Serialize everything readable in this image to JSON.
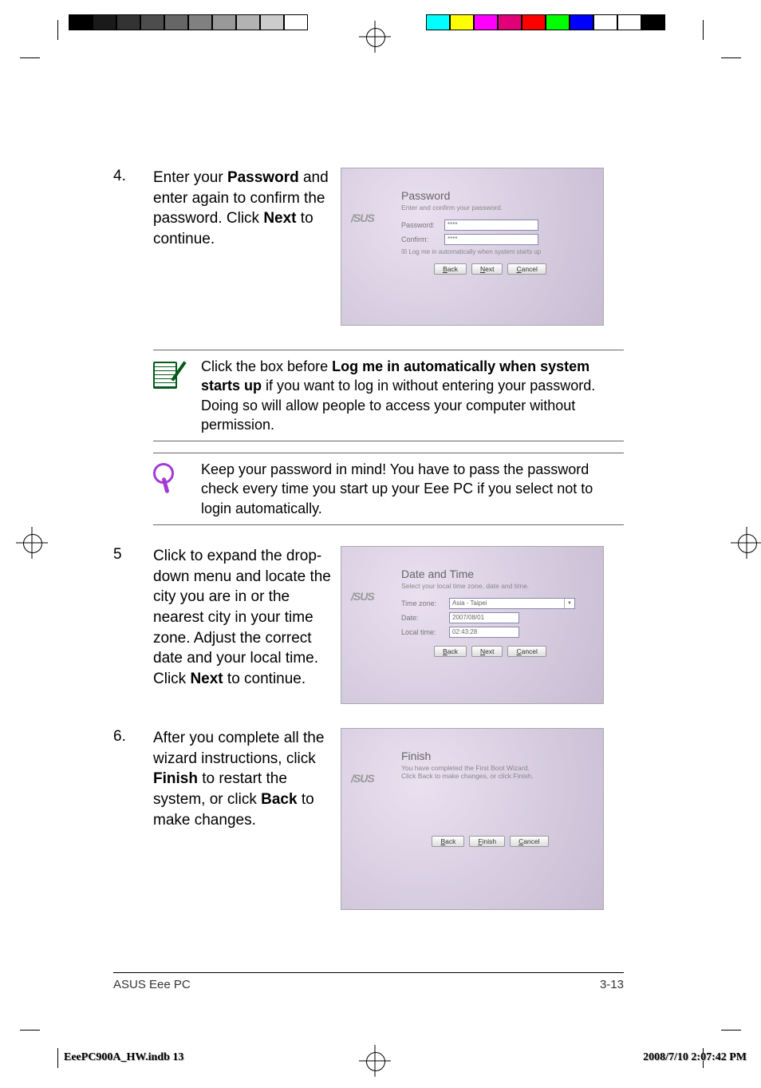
{
  "steps": {
    "s4": {
      "num": "4.",
      "text_pre": "Enter your ",
      "text_b1": "Password",
      "text_mid": " and enter again to confirm the password. Click ",
      "text_b2": "Next",
      "text_post": " to continue."
    },
    "s5": {
      "num": "5",
      "text_pre": "Click to expand the drop-down menu and locate the city you are in or the nearest city in your time zone. Adjust the correct date and your local time. Click ",
      "text_b1": "Next",
      "text_post": " to continue."
    },
    "s6": {
      "num": "6.",
      "text_pre": "After you complete all the wizard instructions, click ",
      "text_b1": "Finish",
      "text_mid": " to restart the system, or click ",
      "text_b2": "Back",
      "text_post": " to make changes."
    }
  },
  "dialogs": {
    "password": {
      "title": "Password",
      "sub": "Enter and confirm your password.",
      "row1_label": "Password:",
      "row1_value": "****",
      "row2_label": "Confirm:",
      "row2_value": "****",
      "chk": "Log me in automatically when system starts up",
      "btn_back": "Back",
      "btn_next": "Next",
      "btn_cancel": "Cancel"
    },
    "datetime": {
      "title": "Date and Time",
      "sub": "Select your local time zone, date and time.",
      "row1_label": "Time zone:",
      "row1_value": "Asia - Taipei",
      "row2_label": "Date:",
      "row2_value": "2007/08/01",
      "row3_label": "Local time:",
      "row3_value": "02:43:28",
      "btn_back": "Back",
      "btn_next": "Next",
      "btn_cancel": "Cancel"
    },
    "finish": {
      "title": "Finish",
      "sub": "You have completed the First Boot Wizard. Click Back to make changes, or click Finish.",
      "btn_back": "Back",
      "btn_finish": "Finish",
      "btn_cancel": "Cancel"
    }
  },
  "notes": {
    "n1": {
      "pre": "Click the box before ",
      "b": "Log me in automatically when system starts up",
      "post": " if you want to log in without entering your password. Doing so will allow people to access your computer without permission."
    },
    "n2": {
      "text": "Keep your password in mind! You have to pass the password check every time you start up your Eee PC if you select not to login automatically."
    }
  },
  "footer": {
    "left": "ASUS Eee PC",
    "right": "3-13"
  },
  "print_footer": {
    "file": "EeePC900A_HW.indb   13",
    "date": "2008/7/10   2:07:42 PM"
  },
  "asus": "/SUS"
}
